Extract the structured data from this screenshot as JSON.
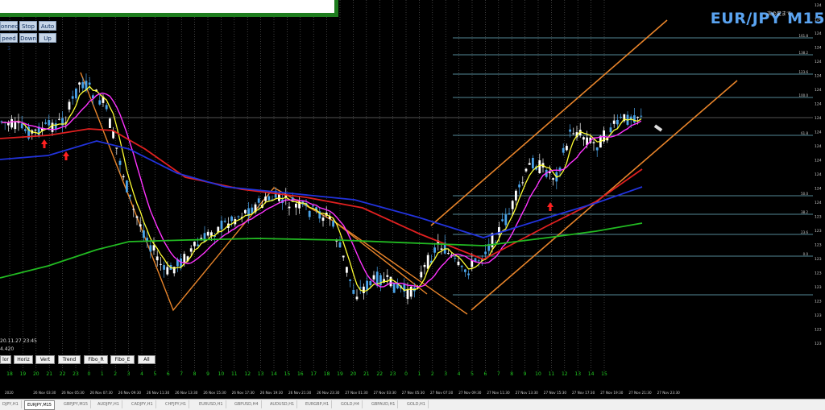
{
  "symbol_title": "EUR/JPY M15",
  "jp_text": "次の足まで",
  "top_controls": [
    {
      "label": "onnect"
    },
    {
      "label": "Stop"
    },
    {
      "label": "Auto"
    },
    {
      "label": "peed 1"
    },
    {
      "label": "Down"
    },
    {
      "label": "Up"
    }
  ],
  "info_lines": [
    "20.11.27 23:45",
    "4.420"
  ],
  "tools": [
    "lor",
    "Horiz",
    "Vert",
    "Trend",
    "Fibo_R",
    "Fibo_E",
    "All"
  ],
  "hour_labels": [
    "18",
    "19",
    "20",
    "21",
    "22",
    "23",
    "0",
    "1",
    "2",
    "3",
    "4",
    "5",
    "6",
    "7",
    "8",
    "9",
    "10",
    "11",
    "12",
    "13",
    "14",
    "15",
    "16",
    "17",
    "18",
    "19",
    "20",
    "21",
    "22",
    "23",
    "0",
    "1",
    "2",
    "3",
    "4",
    "5",
    "6",
    "7",
    "8",
    "9",
    "10",
    "11",
    "12",
    "13",
    "14",
    "15"
  ],
  "time_labels": [
    "2020",
    "26 Nov 03:30",
    "26 Nov 05:30",
    "26 Nov 07:30",
    "26 Nov 09:30",
    "26 Nov 11:30",
    "26 Nov 13:30",
    "26 Nov 15:30",
    "26 Nov 17:30",
    "26 Nov 19:30",
    "26 Nov 21:30",
    "26 Nov 23:30",
    "27 Nov 01:30",
    "27 Nov 03:30",
    "27 Nov 05:30",
    "27 Nov 07:30",
    "27 Nov 09:30",
    "27 Nov 11:30",
    "27 Nov 13:30",
    "27 Nov 15:30",
    "27 Nov 17:30",
    "27 Nov 19:30",
    "27 Nov 21:30",
    "27 Nov 23:30"
  ],
  "price_labels": [
    "124",
    "124",
    "124",
    "124",
    "124",
    "124",
    "124",
    "124",
    "124",
    "124",
    "124",
    "124",
    "124",
    "124",
    "124",
    "123",
    "123",
    "123",
    "123",
    "123",
    "123",
    "123",
    "123",
    "123",
    "123"
  ],
  "fib_labels": [
    "161.8",
    "138.2",
    "123.6",
    "100.0",
    "61.8",
    "50.0",
    "38.2",
    "23.6",
    "0.0"
  ],
  "tabs": [
    "DJPY,H1",
    "EURJPY,M15",
    "GBPJPY,M15",
    "AUDJPY,H1",
    "CADJPY,H1",
    "CHFJPY,H1",
    "EURUSD,H1",
    "GBPUSD,H4",
    "AUDUSD,H1",
    "EURGBP,H1",
    "GOLD,H4",
    "GBPAUD,H1",
    "GOLD,H1"
  ],
  "colors": {
    "up_candle": "#ffffff",
    "down_candle": "#4aa3e8",
    "ma_fast": "#ffff33",
    "ma_mid": "#ff33ff",
    "ma_red": "#e02020",
    "ma_blue": "#2233dd",
    "ma_green": "#22bb22",
    "channel": "#e8842a",
    "fib": "#6fb7c9",
    "arrow": "#ff2020"
  }
}
